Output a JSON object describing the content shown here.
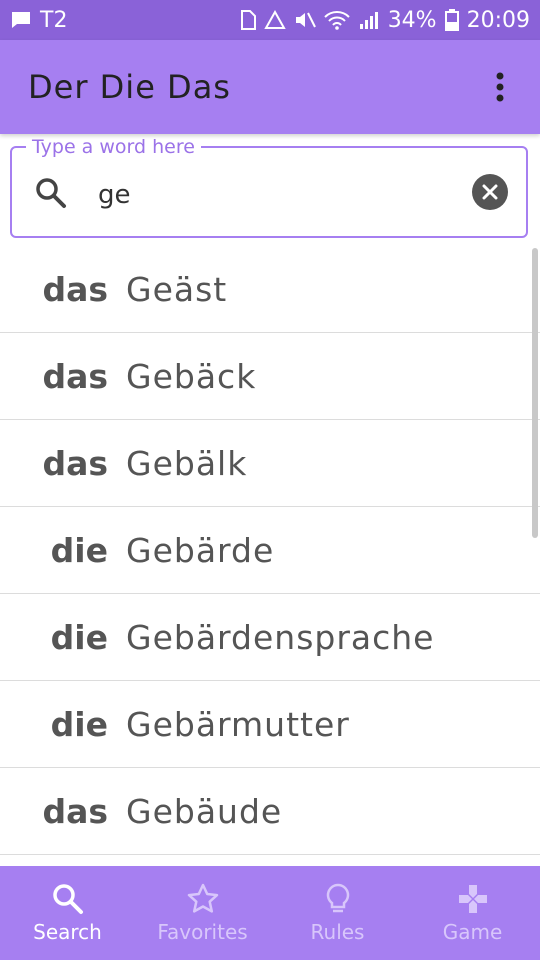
{
  "status_bar": {
    "carrier": "T2",
    "battery": "34%",
    "time": "20:09"
  },
  "app_bar": {
    "title": "Der Die Das"
  },
  "search": {
    "label": "Type a word here",
    "value": "ge"
  },
  "results": [
    {
      "article": "das",
      "word": "Geäst"
    },
    {
      "article": "das",
      "word": "Gebäck"
    },
    {
      "article": "das",
      "word": "Gebälk"
    },
    {
      "article": "die",
      "word": "Gebärde"
    },
    {
      "article": "die",
      "word": "Gebärdensprache"
    },
    {
      "article": "die",
      "word": "Gebärmutter"
    },
    {
      "article": "das",
      "word": "Gebäude"
    }
  ],
  "bottom_nav": {
    "items": [
      {
        "label": "Search",
        "icon": "search-icon",
        "active": true
      },
      {
        "label": "Favorites",
        "icon": "star-icon",
        "active": false
      },
      {
        "label": "Rules",
        "icon": "lightbulb-icon",
        "active": false
      },
      {
        "label": "Game",
        "icon": "gamepad-icon",
        "active": false
      }
    ]
  },
  "colors": {
    "status_bar": "#8a62d8",
    "app_bar": "#a67ff1",
    "accent": "#9b72e8"
  }
}
